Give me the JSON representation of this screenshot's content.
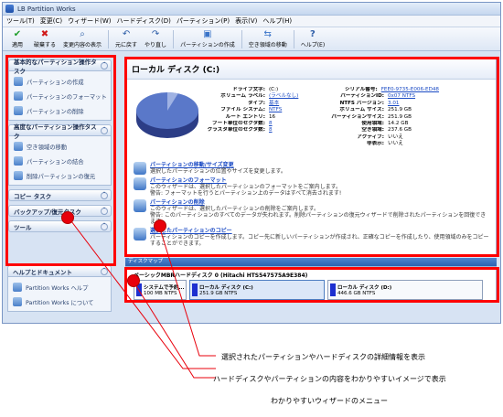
{
  "window": {
    "title": "LB Partition Works"
  },
  "menu": [
    "ツール(T)",
    "変更(C)",
    "ウィザード(W)",
    "ハードディスク(D)",
    "パーティション(P)",
    "表示(V)",
    "ヘルプ(H)"
  ],
  "toolbar": [
    {
      "label": "適用",
      "icon": "check-icon",
      "color": "#1f9e2c",
      "glyph": "✔"
    },
    {
      "label": "破棄する",
      "icon": "cross-icon",
      "color": "#d01919",
      "glyph": "✖"
    },
    {
      "label": "変更内容の表示",
      "icon": "search-icon",
      "color": "#2f5fa8",
      "glyph": "🔍"
    },
    {
      "label": "元に戻す",
      "icon": "undo-icon",
      "color": "#2f5fa8",
      "glyph": "↶"
    },
    {
      "label": "やり直し",
      "icon": "redo-icon",
      "color": "#2f5fa8",
      "glyph": "↷"
    },
    {
      "label": "パーティションの作成",
      "icon": "partition-create-icon",
      "color": "#3a74c8",
      "glyph": "▣"
    },
    {
      "label": "空き領域の移動",
      "icon": "move-space-icon",
      "color": "#3a74c8",
      "glyph": "⇆"
    },
    {
      "label": "ヘルプ(E)",
      "icon": "help-icon",
      "color": "#2f5fa8",
      "glyph": "?"
    }
  ],
  "sidebar": {
    "groups": [
      {
        "title": "基本的なパーティション操作タスク",
        "items": [
          "パーティションの作成",
          "パーティションのフォーマット",
          "パーティションの削除"
        ]
      },
      {
        "title": "高度なパーティション操作タスク",
        "items": [
          "空き領域の移動",
          "パーティションの結合",
          "削除パーティションの復元"
        ]
      }
    ],
    "collapsed": [
      "コピー タスク",
      "バックアップ/復元タスク",
      "ツール"
    ],
    "help": {
      "title": "ヘルプとドキュメント",
      "items": [
        "Partition Works ヘルプ",
        "Partition Works について"
      ]
    }
  },
  "details": {
    "title": "ローカル ディスク (C:)",
    "left": [
      {
        "k": "ドライブ文字:",
        "v": "(C:)"
      },
      {
        "k": "ボリューム ラベル:",
        "v": "(ラベルなし)"
      },
      {
        "k": "タイプ:",
        "v": "基本"
      },
      {
        "k": "ファイル システム:",
        "v": "NTFS"
      },
      {
        "k": "ルート エントリ:",
        "v": "16"
      },
      {
        "k": "ブート単位のセクタ数:",
        "v": "8"
      },
      {
        "k": "クラスタ単位のセクタ数:",
        "v": "8"
      }
    ],
    "right": [
      {
        "k": "シリアル番号:",
        "v": "FEE0-9735-E006-ED48"
      },
      {
        "k": "パーティションID:",
        "v": "0x07 NTFS"
      },
      {
        "k": "NTFS バージョン:",
        "v": "3.01"
      },
      {
        "k": "ボリューム サイズ:",
        "v": "251.9 GB"
      },
      {
        "k": "パーティションサイズ:",
        "v": "251.9 GB"
      },
      {
        "k": "使用領域:",
        "v": "14.2 GB"
      },
      {
        "k": "空き領域:",
        "v": "237.6 GB"
      },
      {
        "k": "アクティブ:",
        "v": "いいえ"
      },
      {
        "k": "非表示:",
        "v": "いいえ"
      }
    ],
    "pie_used_fraction": 0.056,
    "tasks": [
      {
        "title": "パーティションの移動/サイズ変更",
        "desc": "選択したパーティションの位置やサイズを変更します。"
      },
      {
        "title": "パーティションのフォーマット",
        "desc": "このウィザードは、選択したパーティションのフォーマットをご案内します。",
        "warn": "警告: フォーマットを行うとパーティション上のデータはすべて消去されます!"
      },
      {
        "title": "パーティションの削除",
        "desc": "このウィザードは、選択したパーティションの削除をご案内します。",
        "warn": "警告: このパーティションのすべてのデータが失われます。削除パーティションの復元ウィザードで削除されたパーティションを回復できます。"
      },
      {
        "title": "選択したパーティションのコピー",
        "desc": "パーティションのコピーを作成します。コピー先に新しいパーティションが作成され、正確なコピーを作成したり、使用領域のみをコピーすることができます。"
      }
    ]
  },
  "diskmap": {
    "header": "ディスクマップ",
    "disk_label": "ベーシックMBRハードディスク 0 (Hitachi HTS547575A9E384)",
    "partitions": [
      {
        "name": "システムで予約...",
        "size": "100 MB NTFS"
      },
      {
        "name": "ローカル ディスク (C:)",
        "size": "251.9 GB NTFS"
      },
      {
        "name": "ローカル ディスク (D:)",
        "size": "446.6 GB NTFS"
      }
    ]
  },
  "callouts": [
    "選択されたパーティションやハードディスクの詳細情報を表示",
    "ハードディスクやパーティションの内容をわかりやすいイメージで表示",
    "わかりやすいウィザードのメニュー"
  ]
}
